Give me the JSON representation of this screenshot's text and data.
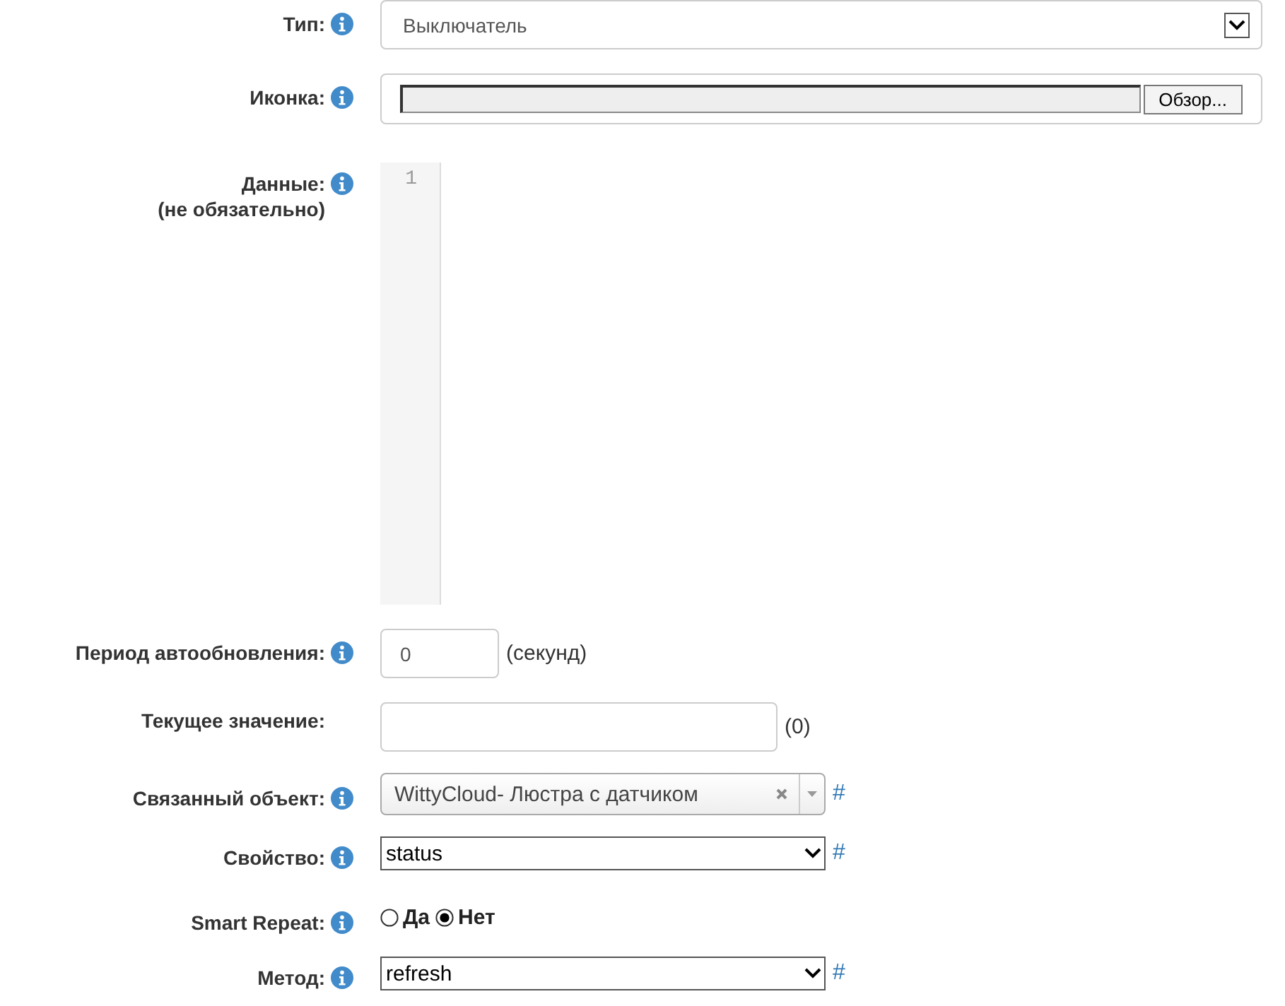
{
  "fields": [
    {
      "kind": "select_box",
      "label": "Тип:",
      "info": true,
      "value": "Выключатель"
    },
    {
      "kind": "file",
      "label": "Иконка:",
      "info": true,
      "button": "Обзор..."
    },
    {
      "kind": "code",
      "label": "Данные:",
      "sublabel": "(не обязательно)",
      "info": true,
      "line_numbers": [
        "1"
      ]
    },
    {
      "kind": "number",
      "label": "Период автообновления:",
      "info": true,
      "value": "0",
      "suffix": "(секунд)"
    },
    {
      "kind": "text",
      "label": "Текущее значение:",
      "info": false,
      "suffix": "(0)"
    },
    {
      "kind": "combo",
      "label": "Связанный объект:",
      "info": true,
      "value": "WittyCloud- Люстра с датчиком",
      "link": "#"
    },
    {
      "kind": "select",
      "label": "Свойство:",
      "info": true,
      "value": "status",
      "link": "#"
    },
    {
      "kind": "radio",
      "label": "Smart Repeat:",
      "info": true,
      "options": [
        {
          "label": "Да",
          "selected": false
        },
        {
          "label": "Нет",
          "selected": true
        }
      ]
    },
    {
      "kind": "select",
      "label": "Метод:",
      "info": true,
      "value": "refresh",
      "link": "#"
    }
  ]
}
